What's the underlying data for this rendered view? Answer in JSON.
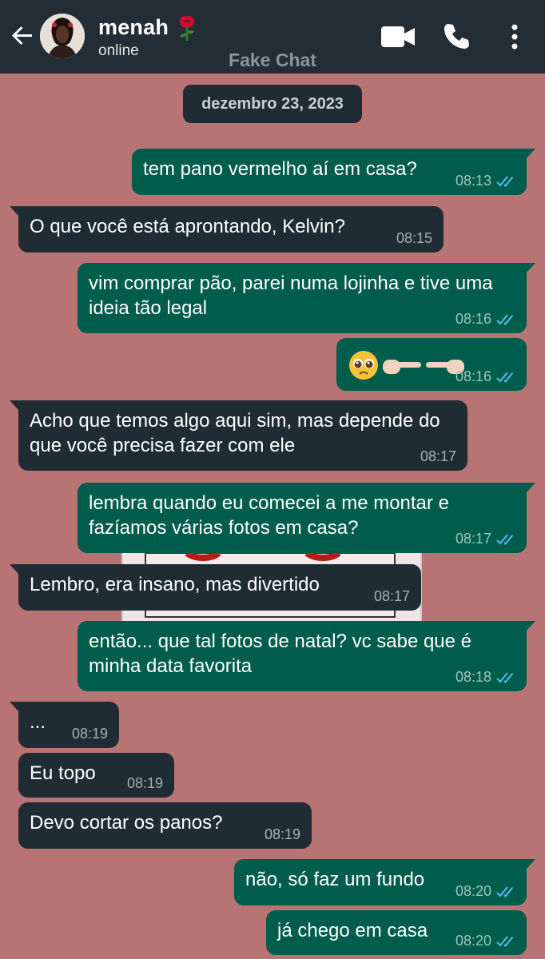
{
  "header": {
    "contact_name": "menah",
    "status": "online",
    "watermark": "Fake Chat"
  },
  "date_label": "dezembro 23, 2023",
  "icons": {
    "back": "arrow-left-icon",
    "rose": "rose-emoji",
    "video": "video-call-icon",
    "phone": "voice-call-icon",
    "more": "more-vertical-icon",
    "read_receipt": "double-check-icon"
  },
  "colors": {
    "header_bg": "#232d36",
    "chat_bg": "#b87474",
    "outgoing_bubble": "#005c4b",
    "incoming_bubble": "#1f2c33",
    "read_ticks": "#53bdeb"
  },
  "messages": [
    {
      "direction": "out",
      "text": "tem pano vermelho aí em casa?",
      "time": "08:13",
      "read": true
    },
    {
      "direction": "in",
      "text": "O que você está aprontando, Kelvin?",
      "time": "08:15"
    },
    {
      "direction": "out",
      "text": "vim comprar pão, parei numa lojinha e tive uma ideia tão legal",
      "time": "08:16",
      "read": true
    },
    {
      "direction": "out",
      "text": "🥺👉🏻👈🏻",
      "time": "08:16",
      "read": true
    },
    {
      "direction": "in",
      "text": "Acho que temos algo aqui sim, mas depende do que você precisa fazer com ele",
      "time": "08:17"
    },
    {
      "direction": "out",
      "text": "lembra quando eu comecei a me montar e fazíamos várias fotos em casa?",
      "time": "08:17",
      "read": true
    },
    {
      "direction": "in",
      "text": "Lembro, era insano, mas divertido",
      "time": "08:17"
    },
    {
      "direction": "out",
      "text": "então... que tal fotos de natal? vc sabe que é minha data favorita",
      "time": "08:18",
      "read": true
    },
    {
      "direction": "in",
      "text": "...",
      "time": "08:19"
    },
    {
      "direction": "in",
      "text": "Eu topo",
      "time": "08:19"
    },
    {
      "direction": "in",
      "text": "Devo cortar os panos?",
      "time": "08:19"
    },
    {
      "direction": "out",
      "text": "não, só faz um fundo",
      "time": "08:20",
      "read": true
    },
    {
      "direction": "out",
      "text": "já chego em casa",
      "time": "08:20",
      "read": true
    }
  ]
}
